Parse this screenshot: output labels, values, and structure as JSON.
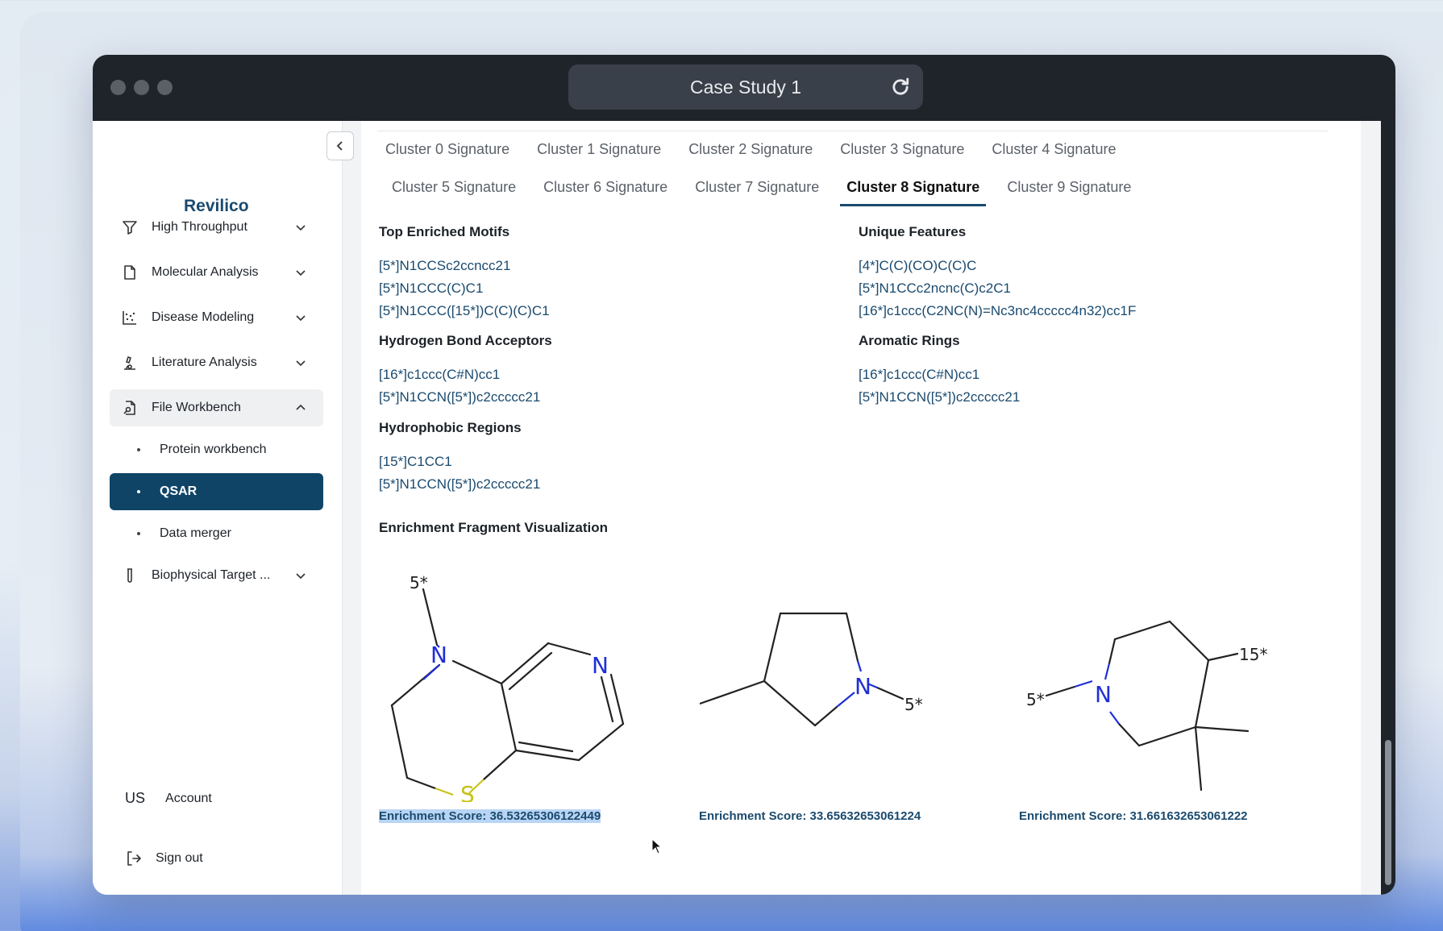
{
  "window": {
    "title": "Case Study 1"
  },
  "sidebar": {
    "brand": "Revilico",
    "items": [
      {
        "label": "High Throughput",
        "icon": "filter-icon"
      },
      {
        "label": "Molecular Analysis",
        "icon": "file-icon"
      },
      {
        "label": "Disease Modeling",
        "icon": "scatter-icon"
      },
      {
        "label": "Literature Analysis",
        "icon": "microscope-icon"
      },
      {
        "label": "File Workbench",
        "icon": "file-search-icon"
      },
      {
        "label": "Biophysical Target ...",
        "icon": "test-tube-icon"
      }
    ],
    "sub_items": [
      {
        "label": "Protein workbench"
      },
      {
        "label": "QSAR"
      },
      {
        "label": "Data merger"
      }
    ],
    "account": {
      "initials": "US",
      "label": "Account"
    },
    "signout": {
      "label": "Sign out"
    }
  },
  "tabs": {
    "row1": [
      "Cluster 0 Signature",
      "Cluster 1 Signature",
      "Cluster 2 Signature",
      "Cluster 3 Signature",
      "Cluster 4 Signature"
    ],
    "row2": [
      "Cluster 5 Signature",
      "Cluster 6 Signature",
      "Cluster 7 Signature",
      "Cluster 8 Signature",
      "Cluster 9 Signature"
    ],
    "active": "Cluster 8 Signature"
  },
  "sections": {
    "top_enriched": {
      "title": "Top Enriched Motifs",
      "items": [
        "[5*]N1CCSc2ccncc21",
        "[5*]N1CCC(C)C1",
        "[5*]N1CCC([15*])C(C)(C)C1"
      ]
    },
    "unique": {
      "title": "Unique Features",
      "items": [
        "[4*]C(C)(CO)C(C)C",
        "[5*]N1CCc2ncnc(C)c2C1",
        "[16*]c1ccc(C2NC(N)=Nc3nc4ccccc4n32)cc1F"
      ]
    },
    "hba": {
      "title": "Hydrogen Bond Acceptors",
      "items": [
        "[16*]c1ccc(C#N)cc1",
        "[5*]N1CCN([5*])c2ccccc21"
      ]
    },
    "aromatic": {
      "title": "Aromatic Rings",
      "items": [
        "[16*]c1ccc(C#N)cc1",
        "[5*]N1CCN([5*])c2ccccc21"
      ]
    },
    "hydrophobic": {
      "title": "Hydrophobic Regions",
      "items": [
        "[15*]C1CC1",
        "[5*]N1CCN([5*])c2ccccc21"
      ]
    },
    "visualization": {
      "title": "Enrichment Fragment Visualization"
    }
  },
  "fragments": [
    {
      "score": "Enrichment Score: 36.53265306122449",
      "atoms": {
        "N": "N",
        "S": "S",
        "N2": "N",
        "label": "5*"
      }
    },
    {
      "score": "Enrichment Score: 33.65632653061224",
      "atoms": {
        "N": "N",
        "label": "5*"
      }
    },
    {
      "score": "Enrichment Score: 31.661632653061222",
      "atoms": {
        "N": "N",
        "label1": "5*",
        "label2": "15*"
      }
    }
  ],
  "colors": {
    "accent": "#0f4467",
    "smiles": "#1a4a6e",
    "nitrogen": "#1f2fd6",
    "sulfur": "#c8c21a"
  }
}
